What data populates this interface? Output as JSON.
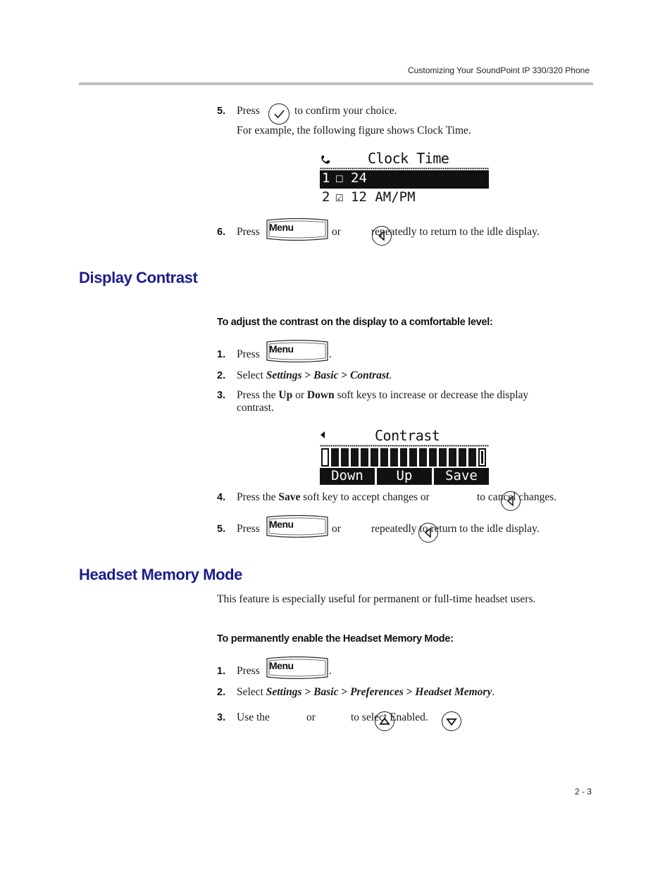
{
  "header": {
    "running_head": "Customizing Your SoundPoint IP 330/320 Phone"
  },
  "clock_section": {
    "step5": {
      "num": "5.",
      "pre": "Press",
      "post": "to confirm your choice.",
      "icon": "checkmark-circle-icon"
    },
    "example_text": "For example, the following figure shows Clock Time.",
    "lcd": {
      "title": "Clock Time",
      "rows": [
        {
          "index": "1",
          "checkbox": "☐",
          "label": "24",
          "selected": true
        },
        {
          "index": "2",
          "checkbox": "☑",
          "label": "12 AM/PM",
          "selected": false
        }
      ]
    },
    "step6": {
      "num": "6.",
      "pre": "Press",
      "menu_key": "Menu",
      "or": "or",
      "post": "repeatedly to return to the idle display.",
      "icon": "back-arrow-circle-icon"
    }
  },
  "display_contrast": {
    "title": "Display Contrast",
    "procedure_title": "To adjust the contrast on the display to a comfortable level:",
    "steps": [
      {
        "num": "1.",
        "pre": "Press",
        "menu_key": "Menu",
        "post": "."
      },
      {
        "num": "2.",
        "pre": "Select ",
        "path": [
          "Settings",
          "Basic",
          "Contrast"
        ],
        "sep": " > ",
        "post": "."
      },
      {
        "num": "3.",
        "line1_pre": "Press the ",
        "up": "Up",
        "or": " or ",
        "down": "Down",
        "line1_post": " soft keys to increase or decrease the display",
        "line2": "contrast."
      },
      {
        "num": "4.",
        "pre": "Press the ",
        "save": "Save",
        "mid": " soft key to accept changes or",
        "post": "to cancel changes."
      },
      {
        "num": "5.",
        "pre": "Press",
        "menu_key": "Menu",
        "or": "or",
        "post": "repeatedly to return to the idle display."
      }
    ],
    "lcd": {
      "title": "Contrast",
      "contrast_level_cells": 15,
      "softkeys": [
        "Down",
        "Up",
        "Save"
      ]
    }
  },
  "headset_memory": {
    "title": "Headset Memory Mode",
    "intro": "This feature is especially useful for permanent or full-time headset users.",
    "procedure_title": "To permanently enable the Headset Memory Mode:",
    "steps": [
      {
        "num": "1.",
        "pre": "Press",
        "menu_key": "Menu",
        "post": "."
      },
      {
        "num": "2.",
        "pre": "Select ",
        "path": [
          "Settings",
          "Basic",
          "Preferences",
          "Headset Memory"
        ],
        "sep": " > ",
        "post": "."
      },
      {
        "num": "3.",
        "pre": "Use the",
        "or": "or",
        "post": "to select Enabled."
      }
    ]
  },
  "footer": {
    "page_number": "2 - 3"
  }
}
